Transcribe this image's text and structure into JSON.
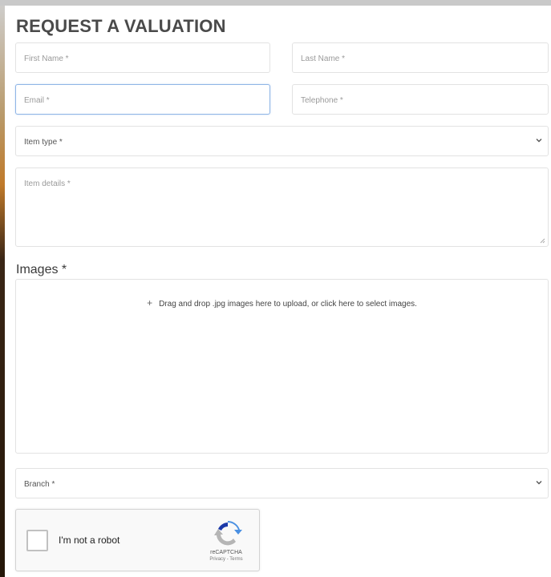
{
  "form": {
    "title": "REQUEST A VALUATION",
    "first_name_placeholder": "First Name *",
    "last_name_placeholder": "Last Name *",
    "email_placeholder": "Email *",
    "telephone_placeholder": "Telephone *",
    "item_type_placeholder": "Item type *",
    "item_details_placeholder": "Item details *",
    "images_label": "Images *",
    "dropzone_text": "Drag and drop .jpg images here to upload, or click here to select images.",
    "branch_placeholder": "Branch *"
  },
  "captcha": {
    "label": "I'm not a robot",
    "brand": "reCAPTCHA",
    "links": "Privacy - Terms"
  },
  "icons": {
    "select_arrow": "chevron-down-icon",
    "dropzone": "plus-icon",
    "captcha_logo": "recaptcha-icon"
  },
  "colors": {
    "focus_border": "#8fb5e6",
    "title": "#4a4a4a"
  }
}
